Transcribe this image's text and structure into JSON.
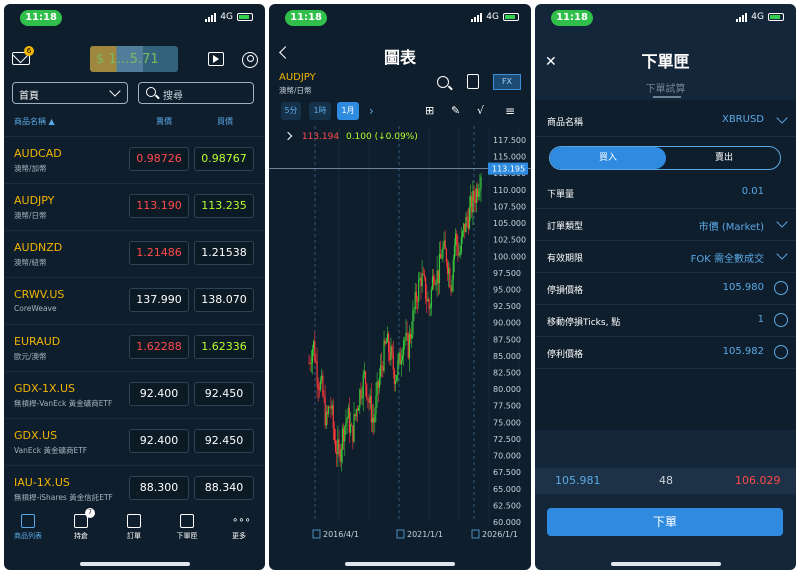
{
  "status": {
    "time": "11:18",
    "network": "4G"
  },
  "watchlist": {
    "mail_badge": "6",
    "account_balance_obscured": "$ 1…5.71",
    "filter": "首頁",
    "search_placeholder": "搜尋",
    "headers": {
      "name": "商品名稱 ▲",
      "bid": "賣價",
      "ask": "買價"
    },
    "rows": [
      {
        "symbol": "AUDCAD",
        "desc": "澳幣/加幣",
        "bid": "0.98726",
        "ask": "0.98767",
        "bid_color": "red",
        "ask_color": "green"
      },
      {
        "symbol": "AUDJPY",
        "desc": "澳幣/日幣",
        "bid": "113.190",
        "ask": "113.235",
        "bid_color": "red",
        "ask_color": "green"
      },
      {
        "symbol": "AUDNZD",
        "desc": "澳幣/紐幣",
        "bid": "1.21486",
        "ask": "1.21538",
        "bid_color": "red",
        "ask_color": "white"
      },
      {
        "symbol": "CRWV.US",
        "desc": "CoreWeave",
        "bid": "137.990",
        "ask": "138.070",
        "bid_color": "white",
        "ask_color": "white"
      },
      {
        "symbol": "EURAUD",
        "desc": "歐元/澳幣",
        "bid": "1.62288",
        "ask": "1.62336",
        "bid_color": "red",
        "ask_color": "green"
      },
      {
        "symbol": "GDX-1X.US",
        "desc": "無槓桿-VanEck 黃金礦商ETF",
        "bid": "92.400",
        "ask": "92.450",
        "bid_color": "white",
        "ask_color": "white"
      },
      {
        "symbol": "GDX.US",
        "desc": "VanEck 黃金礦商ETF",
        "bid": "92.400",
        "ask": "92.450",
        "bid_color": "white",
        "ask_color": "white"
      },
      {
        "symbol": "IAU-1X.US",
        "desc": "無槓桿-iShares 黃金信託ETF",
        "bid": "88.300",
        "ask": "88.340",
        "bid_color": "white",
        "ask_color": "white"
      }
    ],
    "tabs": [
      {
        "label": "商品列表",
        "icon": "list-icon"
      },
      {
        "label": "持倉",
        "icon": "briefcase-icon",
        "badge": "7"
      },
      {
        "label": "訂單",
        "icon": "cart-icon"
      },
      {
        "label": "下單匣",
        "icon": "cart-plus-icon"
      },
      {
        "label": "更多",
        "icon": "more-icon"
      }
    ]
  },
  "chart": {
    "title": "圖表",
    "symbol": "AUDJPY",
    "subtitle": "澳幣/日幣",
    "fx_label": "FX",
    "timeframes": [
      "5分",
      "1時",
      "1月"
    ],
    "active_timeframe": "1月",
    "ohlc_text": "113.194",
    "change_text": "0.100 (↓0.09%)",
    "price_tag": "113.195",
    "y_ticks": [
      "117.500",
      "115.000",
      "112.500",
      "110.000",
      "107.500",
      "105.000",
      "102.500",
      "100.000",
      "97.500",
      "95.000",
      "92.500",
      "90.000",
      "87.500",
      "85.000",
      "82.500",
      "80.000",
      "77.500",
      "75.000",
      "72.500",
      "70.000",
      "67.500",
      "65.000",
      "62.500",
      "60.000"
    ],
    "x_labels": [
      "2016/4/1",
      "2021/1/1",
      "2026/1/1"
    ]
  },
  "chart_data": {
    "type": "candlestick",
    "x_labels": [
      "2016/4/1",
      "2021/1/1",
      "2026/1/1"
    ],
    "ylim": [
      60,
      117.5
    ],
    "last_price": 113.195,
    "close_series_approx": [
      84,
      87,
      82,
      80,
      75,
      78,
      72,
      70,
      74,
      76,
      73,
      77,
      80,
      82,
      78,
      75,
      80,
      84,
      87,
      85,
      82,
      84,
      88,
      86,
      90,
      94,
      97,
      95,
      92,
      98,
      97,
      101,
      100,
      96,
      103,
      100,
      104,
      106,
      108,
      110,
      113
    ]
  },
  "order": {
    "title": "下單匣",
    "subtitle": "下單試算",
    "fields": [
      {
        "label": "商品名稱",
        "value": "XBRUSD",
        "control": "chevron"
      },
      {
        "label": "下單量",
        "value": "0.01",
        "control": "none"
      },
      {
        "label": "訂單類型",
        "value": "市價 (Market)",
        "control": "chevron"
      },
      {
        "label": "有效期限",
        "value": "FOK 需全數成交",
        "control": "chevron"
      },
      {
        "label": "停損價格",
        "value": "105.980",
        "control": "radio"
      },
      {
        "label": "移動停損Ticks, 點",
        "value": "1",
        "control": "radio"
      },
      {
        "label": "停利價格",
        "value": "105.982",
        "control": "radio"
      }
    ],
    "buy_label": "買入",
    "sell_label": "賣出",
    "quote_bid": "105.981",
    "quote_spread": "48",
    "quote_ask": "106.029",
    "submit_label": "下單"
  }
}
